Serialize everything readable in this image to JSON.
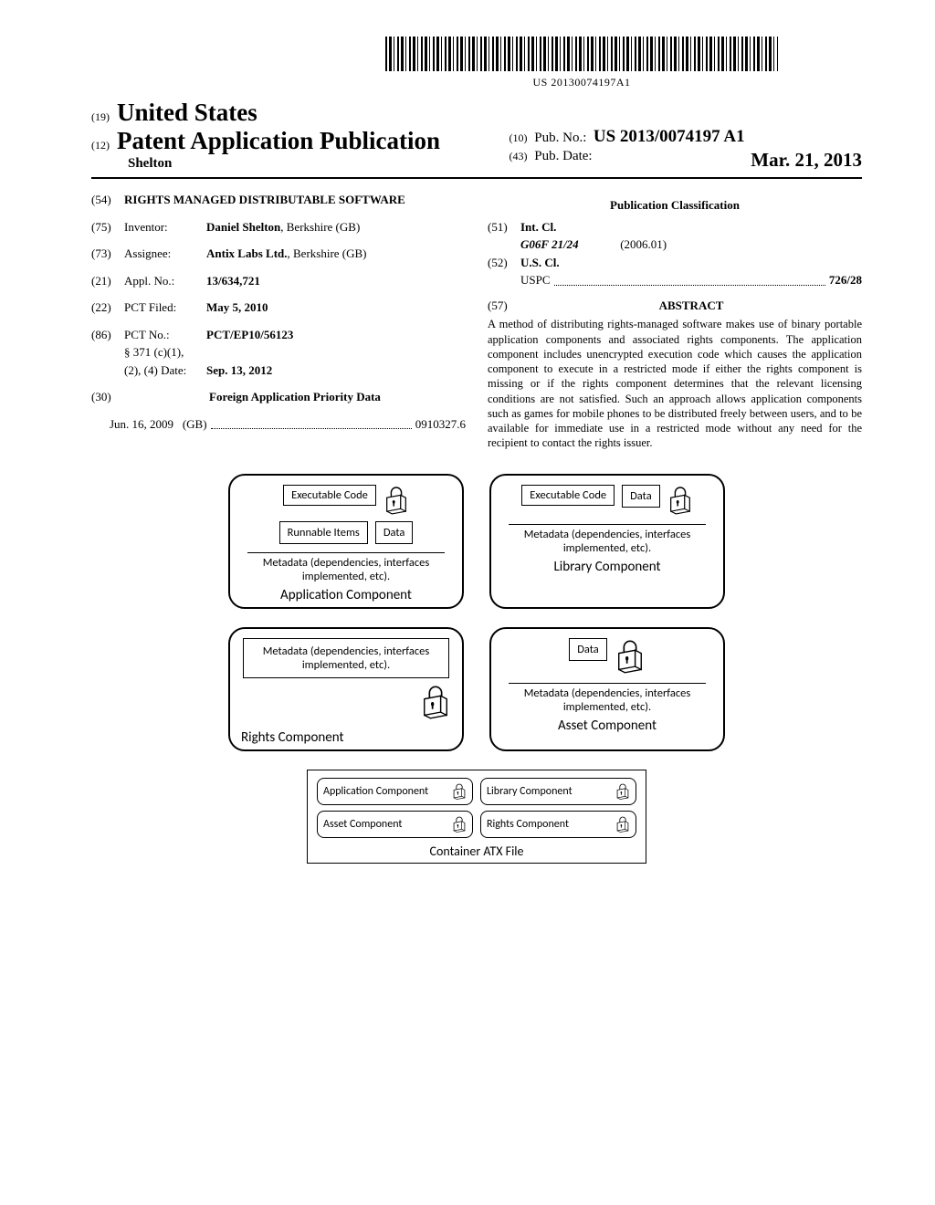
{
  "barcode_number": "US 20130074197A1",
  "header": {
    "country_code": "(19)",
    "country": "United States",
    "pub_type_code": "(12)",
    "pub_type": "Patent Application Publication",
    "author": "Shelton",
    "pub_no_code": "(10)",
    "pub_no_label": "Pub. No.:",
    "pub_no": "US 2013/0074197 A1",
    "pub_date_code": "(43)",
    "pub_date_label": "Pub. Date:",
    "pub_date": "Mar. 21, 2013"
  },
  "left_column": {
    "title_code": "(54)",
    "title": "RIGHTS MANAGED DISTRIBUTABLE SOFTWARE",
    "inventor_code": "(75)",
    "inventor_label": "Inventor:",
    "inventor": "Daniel Shelton",
    "inventor_loc": ", Berkshire (GB)",
    "assignee_code": "(73)",
    "assignee_label": "Assignee:",
    "assignee": "Antix Labs Ltd.",
    "assignee_loc": ", Berkshire (GB)",
    "appl_code": "(21)",
    "appl_label": "Appl. No.:",
    "appl_no": "13/634,721",
    "pct_filed_code": "(22)",
    "pct_filed_label": "PCT Filed:",
    "pct_filed": "May 5, 2010",
    "pct_no_code": "(86)",
    "pct_no_label": "PCT No.:",
    "pct_no": "PCT/EP10/56123",
    "sec371_label": "§ 371 (c)(1),",
    "sec371_date_label": "(2), (4) Date:",
    "sec371_date": "Sep. 13, 2012",
    "foreign_code": "(30)",
    "foreign_heading": "Foreign Application Priority Data",
    "foreign_date": "Jun. 16, 2009",
    "foreign_cc": "(GB)",
    "foreign_num": "0910327.6"
  },
  "right_column": {
    "classification_heading": "Publication Classification",
    "intcl_code": "(51)",
    "intcl_label": "Int. Cl.",
    "intcl_val": "G06F 21/24",
    "intcl_year": "(2006.01)",
    "uscl_code": "(52)",
    "uscl_label": "U.S. Cl.",
    "uspc_label": "USPC",
    "uspc_val": "726/28",
    "abstract_code": "(57)",
    "abstract_heading": "ABSTRACT",
    "abstract_text": "A method of distributing rights-managed software makes use of binary portable application components and associated rights components. The application component includes unencrypted execution code which causes the application component to execute in a restricted mode if either the rights component is missing or if the rights component determines that the relevant licensing conditions are not satisfied. Such an approach allows application components such as games for mobile phones to be distributed freely between users, and to be available for immediate use in a restricted mode without any need for the recipient to contact the rights issuer."
  },
  "diagram": {
    "exec_code": "Executable Code",
    "runnable": "Runnable Items",
    "data": "Data",
    "metadata": "Metadata (dependencies, interfaces implemented, etc).",
    "app_comp": "Application Component",
    "lib_comp": "Library Component",
    "rights_comp": "Rights Component",
    "asset_comp": "Asset Component",
    "container": "Container ATX File",
    "app_comp_short": "Application Component",
    "lib_comp_short": "Library Component",
    "asset_comp_short": "Asset Component",
    "rights_comp_short": "Rights Component"
  }
}
